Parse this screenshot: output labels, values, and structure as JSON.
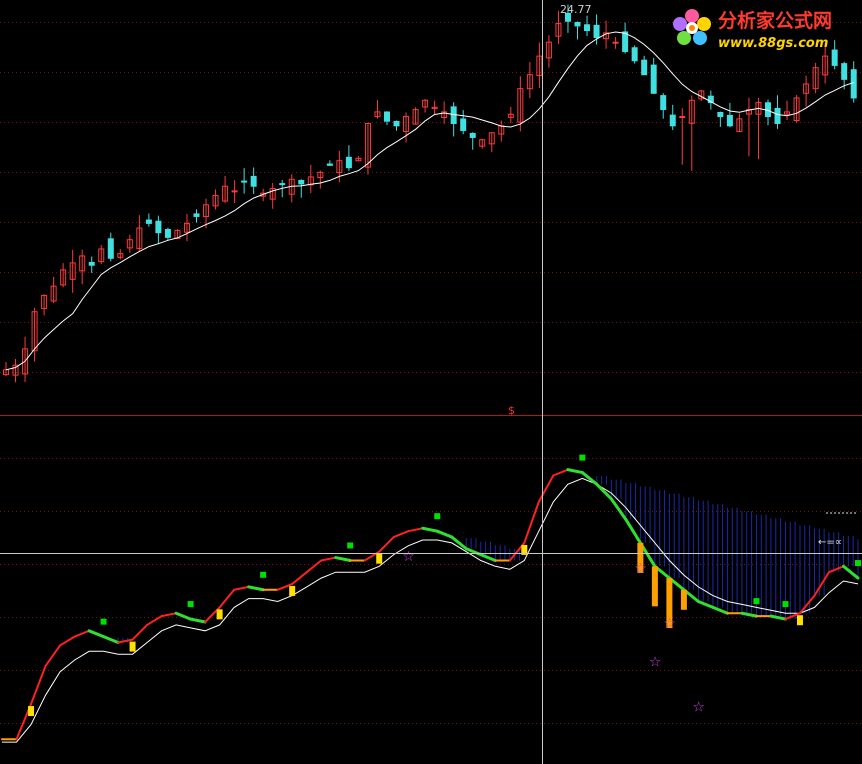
{
  "watermark": {
    "title": "分析家公式网",
    "url": "www.88gs.com"
  },
  "price_panel": {
    "high_label": "24.77"
  },
  "divider_marker": "$",
  "indicator_panel": {
    "cross_label": "←=∝"
  },
  "colors": {
    "up": "#ff3a3a",
    "down": "#40e0e0",
    "ma": "#ffffff",
    "grid": "#7a1010",
    "divider": "#b01818",
    "crosshair": "#c8c8c8",
    "fill": "#1a2aa8",
    "line_up": "#ff2020",
    "line_down": "#30e030",
    "line_mid": "#ffa000",
    "signal_yellow": "#ffe000",
    "signal_green": "#00e000",
    "bar_orange": "#ffa000",
    "star": "#cc44dd"
  },
  "chart_data": [
    {
      "type": "candlestick",
      "xlabel": "",
      "ylabel": "",
      "ylim": [
        8,
        25
      ],
      "grid": true,
      "annotations": [
        "24.77"
      ],
      "series": [
        {
          "values": [
            9.3,
            9.5,
            10.2,
            11.8,
            12.5,
            12.9,
            13.6,
            13.9,
            14.2,
            13.8,
            14.5,
            14.1,
            14.3,
            14.9,
            15.4,
            15.6,
            15.2,
            15.0,
            15.3,
            15.6,
            15.9,
            16.4,
            16.8,
            17.2,
            17.0,
            17.4,
            17.2,
            16.9,
            17.1,
            17.3,
            17.5,
            17.3,
            17.6,
            17.8,
            18.1,
            18.3,
            18.0,
            18.4,
            19.9,
            20.4,
            20.0,
            19.8,
            20.2,
            20.5,
            20.9,
            20.6,
            20.4,
            19.9,
            19.6,
            19.3,
            19.2,
            19.5,
            19.8,
            20.3,
            21.4,
            22.0,
            22.8,
            23.4,
            24.2,
            24.3,
            24.1,
            23.9,
            23.6,
            23.8,
            23.4,
            23.0,
            22.6,
            22.0,
            21.2,
            20.5,
            19.8,
            20.2,
            20.9,
            21.3,
            20.8,
            20.2,
            19.8,
            20.1,
            20.5,
            20.8,
            20.2,
            19.9,
            20.4,
            21.0,
            21.6,
            22.3,
            22.8,
            22.4,
            21.8,
            21.0
          ]
        }
      ]
    },
    {
      "type": "line",
      "xlabel": "",
      "ylabel": "",
      "ylim": [
        0,
        100
      ],
      "grid": true,
      "annotations": [
        "←=∝"
      ],
      "series": [
        {
          "values": [
            3,
            3,
            15,
            28,
            35,
            38,
            40,
            38,
            36,
            37,
            42,
            45,
            46,
            44,
            43,
            48,
            54,
            55,
            54,
            54,
            56,
            60,
            64,
            65,
            64,
            64,
            67,
            72,
            74,
            75,
            74,
            72,
            68,
            66,
            64,
            64,
            70,
            84,
            93,
            95,
            94,
            90,
            85,
            78,
            70,
            62,
            58,
            54,
            50,
            48,
            46,
            46,
            45,
            45,
            44,
            46,
            52,
            60,
            62,
            58
          ]
        },
        {
          "values": [
            2,
            2,
            8,
            18,
            26,
            30,
            33,
            33,
            32,
            32,
            36,
            40,
            42,
            41,
            40,
            42,
            48,
            51,
            51,
            50,
            52,
            55,
            58,
            60,
            60,
            60,
            62,
            66,
            69,
            71,
            71,
            70,
            67,
            64,
            62,
            61,
            64,
            74,
            84,
            90,
            92,
            90,
            87,
            82,
            76,
            70,
            64,
            59,
            55,
            52,
            50,
            49,
            48,
            47,
            46,
            46,
            48,
            53,
            57,
            56
          ]
        },
        {
          "values": [
            0,
            0,
            0,
            0,
            0,
            0,
            0,
            0,
            0,
            0,
            0,
            0,
            0,
            0,
            0,
            0,
            0,
            0,
            0,
            0,
            0,
            0,
            0,
            0,
            0,
            0,
            0,
            0,
            0,
            0,
            0,
            0,
            0,
            0,
            0,
            0,
            0,
            0,
            0,
            0,
            0,
            0,
            0,
            0,
            0,
            0,
            0,
            0,
            0,
            0,
            0,
            0,
            0,
            0,
            0,
            0,
            0,
            0,
            0,
            0
          ]
        }
      ]
    }
  ]
}
